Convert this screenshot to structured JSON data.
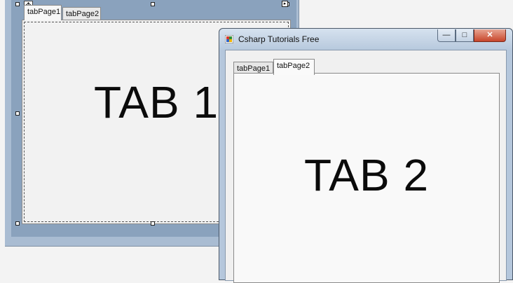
{
  "designer": {
    "tabs": [
      "tabPage1",
      "tabPage2"
    ],
    "page_label": "TAB 1"
  },
  "app": {
    "title": "Csharp Tutorials Free",
    "tabs": [
      "tabPage1",
      "tabPage2"
    ],
    "page_label": "TAB 2",
    "minimize": "—",
    "maximize": "□",
    "close": "✕"
  }
}
